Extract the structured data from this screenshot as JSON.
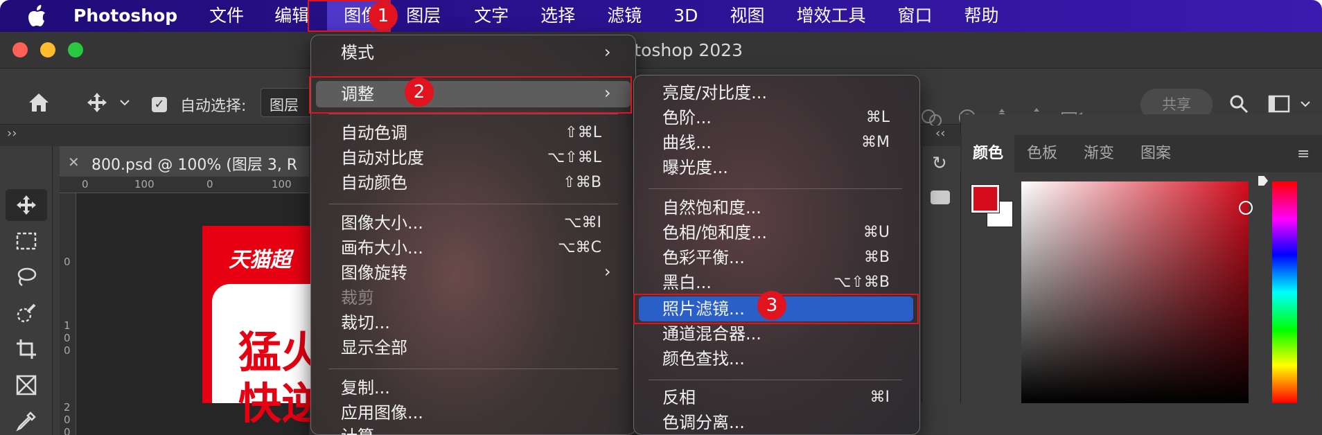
{
  "menubar": {
    "app_name": "Photoshop",
    "items": [
      "文件",
      "编辑",
      "图像",
      "图层",
      "文字",
      "选择",
      "滤镜",
      "3D",
      "视图",
      "增效工具",
      "窗口",
      "帮助"
    ]
  },
  "window": {
    "title": "otoshop 2023"
  },
  "options": {
    "auto_select_label": "自动选择:",
    "layer_select": "图层",
    "share_label": "共享"
  },
  "document": {
    "tab_label": "800.psd @ 100% (图层 3, R"
  },
  "rulers": {
    "h": [
      "0",
      "100",
      "0",
      "100"
    ],
    "v": [
      "0",
      "1\n0\n0",
      "2\n0\n0"
    ]
  },
  "canvas": {
    "art_title": "天猫超",
    "big1": "猛火",
    "big2": "快逆"
  },
  "panels": {
    "tabs": [
      "颜色",
      "色板",
      "渐变",
      "图案"
    ]
  },
  "colors": {
    "foreground": "#d40c1c",
    "background": "#ffffff",
    "accent_blue": "#2a5fc8",
    "annotation_red": "#e0131e"
  },
  "image_menu": {
    "mode": "模式",
    "adjust": "调整",
    "auto_tone": "自动色调",
    "auto_tone_sc": "⇧⌘L",
    "auto_contrast": "自动对比度",
    "auto_contrast_sc": "⌥⇧⌘L",
    "auto_color": "自动颜色",
    "auto_color_sc": "⇧⌘B",
    "image_size": "图像大小...",
    "image_size_sc": "⌥⌘I",
    "canvas_size": "画布大小...",
    "canvas_size_sc": "⌥⌘C",
    "rotation": "图像旋转",
    "crop": "裁剪",
    "trim": "裁切...",
    "reveal_all": "显示全部",
    "duplicate": "复制...",
    "apply_image": "应用图像...",
    "calculations": "计算..."
  },
  "adjust_menu": {
    "brightness": "亮度/对比度...",
    "levels": "色阶...",
    "levels_sc": "⌘L",
    "curves": "曲线...",
    "curves_sc": "⌘M",
    "exposure": "曝光度...",
    "vibrance": "自然饱和度...",
    "hue_sat": "色相/饱和度...",
    "hue_sat_sc": "⌘U",
    "color_balance": "色彩平衡...",
    "color_balance_sc": "⌘B",
    "bw": "黑白...",
    "bw_sc": "⌥⇧⌘B",
    "photo_filter": "照片滤镜...",
    "channel_mixer": "通道混合器...",
    "color_lookup": "颜色查找...",
    "invert": "反相",
    "invert_sc": "⌘I",
    "posterize": "色调分离..."
  },
  "annotations": {
    "badge1": "1",
    "badge2": "2",
    "badge3": "3"
  }
}
